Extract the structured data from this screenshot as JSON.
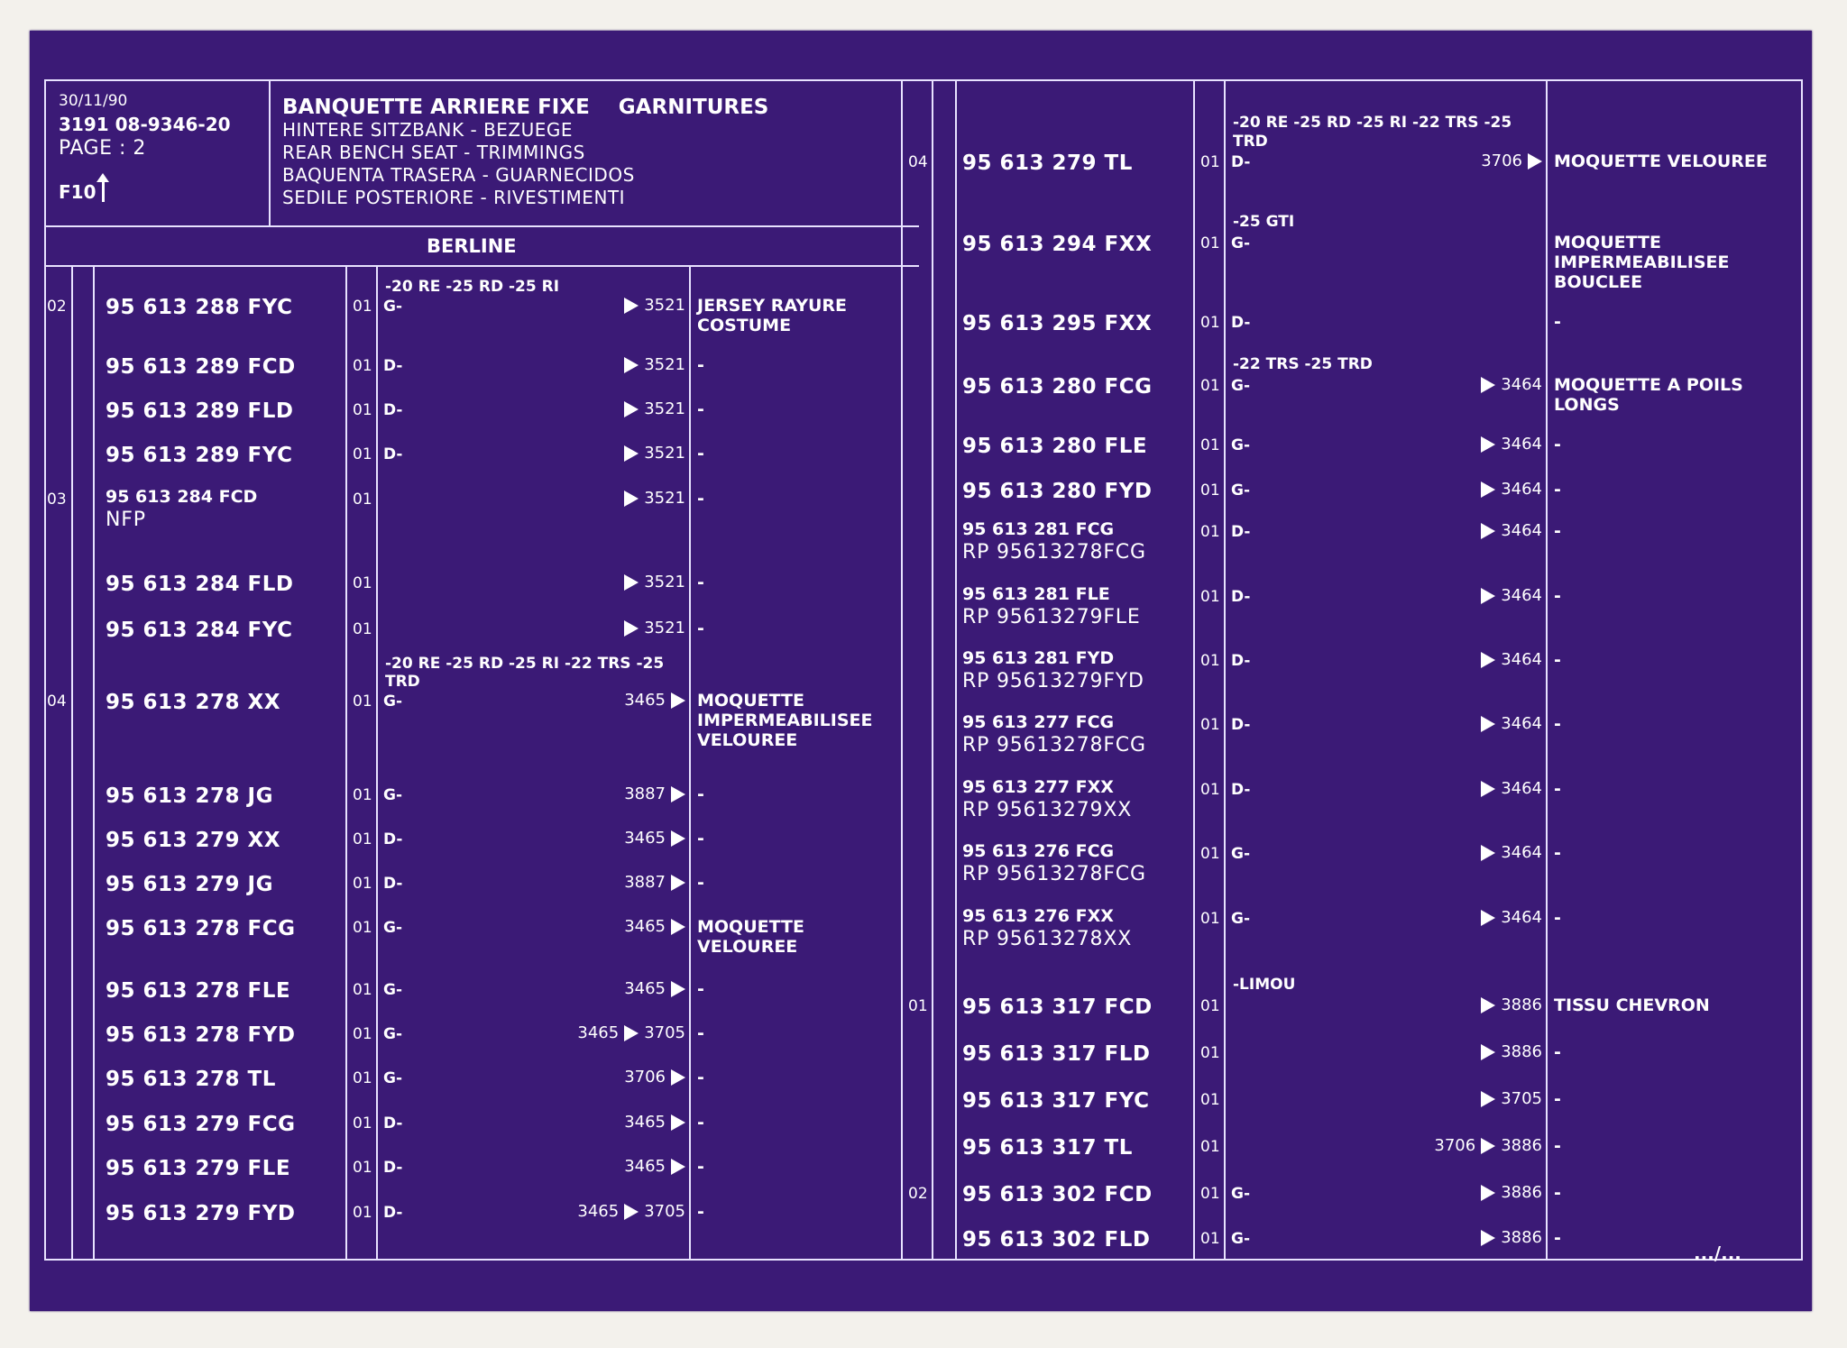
{
  "header": {
    "date": "30/11/90",
    "code": "3191  08-9346-20",
    "page": "PAGE : 2",
    "fig": "F10",
    "titles": [
      "BANQUETTE ARRIERE FIXE    GARNITURES",
      "HINTERE SITZBANK - BEZUEGE",
      "REAR BENCH SEAT - TRIMMINGS",
      "BAQUENTA TRASERA - GUARNECIDOS",
      "SEDILE POSTERIORE - RIVESTIMENTI"
    ],
    "section": "BERLINE",
    "continued": ".../..."
  },
  "left_rows": [
    {
      "ref": "02",
      "pre": "-20 RE -25 RD -25 RI",
      "part": "95 613 288 FYC",
      "qty": "01",
      "side": "G-",
      "n1": "",
      "n2": "3521",
      "desc": "JERSEY RAYURE COSTUME"
    },
    {
      "ref": "",
      "pre": "",
      "part": "95 613 289 FCD",
      "qty": "01",
      "side": "D-",
      "n1": "",
      "n2": "3521",
      "desc": "-"
    },
    {
      "ref": "",
      "pre": "",
      "part": "95 613 289 FLD",
      "qty": "01",
      "side": "D-",
      "n1": "",
      "n2": "3521",
      "desc": "-"
    },
    {
      "ref": "",
      "pre": "",
      "part": "95 613 289 FYC",
      "qty": "01",
      "side": "D-",
      "n1": "",
      "n2": "3521",
      "desc": "-"
    },
    {
      "ref": "03",
      "pre": "",
      "part": "95 613 284 FCD",
      "sub": "NFP",
      "qty": "01",
      "side": "",
      "n1": "",
      "n2": "3521",
      "desc": "-"
    },
    {
      "ref": "",
      "pre": "",
      "part": "95 613 284 FLD",
      "qty": "01",
      "side": "",
      "n1": "",
      "n2": "3521",
      "desc": "-"
    },
    {
      "ref": "",
      "pre": "",
      "part": "95 613 284 FYC",
      "qty": "01",
      "side": "",
      "n1": "",
      "n2": "3521",
      "desc": "-"
    },
    {
      "ref": "04",
      "pre": "-20 RE -25 RD -25 RI -22 TRS -25 TRD",
      "part": "95 613 278 XX",
      "qty": "01",
      "side": "G-",
      "n1": "3465",
      "n2": "",
      "desc": "MOQUETTE IMPERMEABILISEE VELOUREE"
    },
    {
      "ref": "",
      "pre": "",
      "part": "95 613 278 JG",
      "qty": "01",
      "side": "G-",
      "n1": "3887",
      "n2": "",
      "desc": "-"
    },
    {
      "ref": "",
      "pre": "",
      "part": "95 613 279 XX",
      "qty": "01",
      "side": "D-",
      "n1": "3465",
      "n2": "",
      "desc": "-"
    },
    {
      "ref": "",
      "pre": "",
      "part": "95 613 279 JG",
      "qty": "01",
      "side": "D-",
      "n1": "3887",
      "n2": "",
      "desc": "-"
    },
    {
      "ref": "",
      "pre": "",
      "part": "95 613 278 FCG",
      "qty": "01",
      "side": "G-",
      "n1": "3465",
      "n2": "",
      "desc": "MOQUETTE VELOUREE"
    },
    {
      "ref": "",
      "pre": "",
      "part": "95 613 278 FLE",
      "qty": "01",
      "side": "G-",
      "n1": "3465",
      "n2": "",
      "desc": "-"
    },
    {
      "ref": "",
      "pre": "",
      "part": "95 613 278 FYD",
      "qty": "01",
      "side": "G-",
      "n1": "3465",
      "n2": "3705",
      "desc": "-"
    },
    {
      "ref": "",
      "pre": "",
      "part": "95 613 278 TL",
      "qty": "01",
      "side": "G-",
      "n1": "3706",
      "n2": "",
      "desc": "-"
    },
    {
      "ref": "",
      "pre": "",
      "part": "95 613 279 FCG",
      "qty": "01",
      "side": "D-",
      "n1": "3465",
      "n2": "",
      "desc": "-"
    },
    {
      "ref": "",
      "pre": "",
      "part": "95 613 279 FLE",
      "qty": "01",
      "side": "D-",
      "n1": "3465",
      "n2": "",
      "desc": "-"
    },
    {
      "ref": "",
      "pre": "",
      "part": "95 613 279 FYD",
      "qty": "01",
      "side": "D-",
      "n1": "3465",
      "n2": "3705",
      "desc": "-"
    }
  ],
  "right_rows": [
    {
      "ref": "04",
      "pre": "-20 RE -25 RD -25 RI -22 TRS -25 TRD",
      "part": "95 613 279 TL",
      "qty": "01",
      "side": "D-",
      "n1": "3706",
      "n2": "",
      "desc": "MOQUETTE VELOUREE"
    },
    {
      "ref": "",
      "pre": "-25 GTI",
      "part": "95 613 294 FXX",
      "qty": "01",
      "side": "G-",
      "n1": "",
      "n2": "",
      "desc": "MOQUETTE IMPERMEABILISEE BOUCLEE"
    },
    {
      "ref": "",
      "pre": "",
      "part": "95 613 295 FXX",
      "qty": "01",
      "side": "D-",
      "n1": "",
      "n2": "",
      "desc": "-"
    },
    {
      "ref": "",
      "pre": "-22 TRS -25 TRD",
      "part": "95 613 280 FCG",
      "qty": "01",
      "side": "G-",
      "n1": "",
      "n2": "3464",
      "desc": "MOQUETTE A POILS LONGS"
    },
    {
      "ref": "",
      "pre": "",
      "part": "95 613 280 FLE",
      "qty": "01",
      "side": "G-",
      "n1": "",
      "n2": "3464",
      "desc": "-"
    },
    {
      "ref": "",
      "pre": "",
      "part": "95 613 280 FYD",
      "qty": "01",
      "side": "G-",
      "n1": "",
      "n2": "3464",
      "desc": "-"
    },
    {
      "ref": "",
      "pre": "",
      "part": "95 613 281 FCG",
      "sub": "RP  95613278FCG",
      "qty": "01",
      "side": "D-",
      "n1": "",
      "n2": "3464",
      "desc": "-"
    },
    {
      "ref": "",
      "pre": "",
      "part": "95 613 281 FLE",
      "sub": "RP  95613279FLE",
      "qty": "01",
      "side": "D-",
      "n1": "",
      "n2": "3464",
      "desc": "-"
    },
    {
      "ref": "",
      "pre": "",
      "part": "95 613 281 FYD",
      "sub": "RP  95613279FYD",
      "qty": "01",
      "side": "D-",
      "n1": "",
      "n2": "3464",
      "desc": "-"
    },
    {
      "ref": "",
      "pre": "",
      "part": "95 613 277 FCG",
      "sub": "RP  95613278FCG",
      "qty": "01",
      "side": "D-",
      "n1": "",
      "n2": "3464",
      "desc": "-"
    },
    {
      "ref": "",
      "pre": "",
      "part": "95 613 277 FXX",
      "sub": "RP  95613279XX",
      "qty": "01",
      "side": "D-",
      "n1": "",
      "n2": "3464",
      "desc": "-"
    },
    {
      "ref": "",
      "pre": "",
      "part": "95 613 276 FCG",
      "sub": "RP  95613278FCG",
      "qty": "01",
      "side": "G-",
      "n1": "",
      "n2": "3464",
      "desc": "-"
    },
    {
      "ref": "",
      "pre": "",
      "part": "95 613 276 FXX",
      "sub": "RP  95613278XX",
      "qty": "01",
      "side": "G-",
      "n1": "",
      "n2": "3464",
      "desc": "-"
    },
    {
      "ref": "01",
      "pre": "-LIMOU",
      "part": "95 613 317 FCD",
      "qty": "01",
      "side": "",
      "n1": "",
      "n2": "3886",
      "desc": "TISSU CHEVRON"
    },
    {
      "ref": "",
      "pre": "",
      "part": "95 613 317 FLD",
      "qty": "01",
      "side": "",
      "n1": "",
      "n2": "3886",
      "desc": "-"
    },
    {
      "ref": "",
      "pre": "",
      "part": "95 613 317 FYC",
      "qty": "01",
      "side": "",
      "n1": "",
      "n2": "3705",
      "desc": "-"
    },
    {
      "ref": "",
      "pre": "",
      "part": "95 613 317 TL",
      "qty": "01",
      "side": "",
      "n1": "3706",
      "n2": "3886",
      "desc": "-"
    },
    {
      "ref": "02",
      "pre": "",
      "part": "95 613 302 FCD",
      "qty": "01",
      "side": "G-",
      "n1": "",
      "n2": "3886",
      "desc": "-"
    },
    {
      "ref": "",
      "pre": "",
      "part": "95 613 302 FLD",
      "qty": "01",
      "side": "G-",
      "n1": "",
      "n2": "3886",
      "desc": "-"
    }
  ]
}
